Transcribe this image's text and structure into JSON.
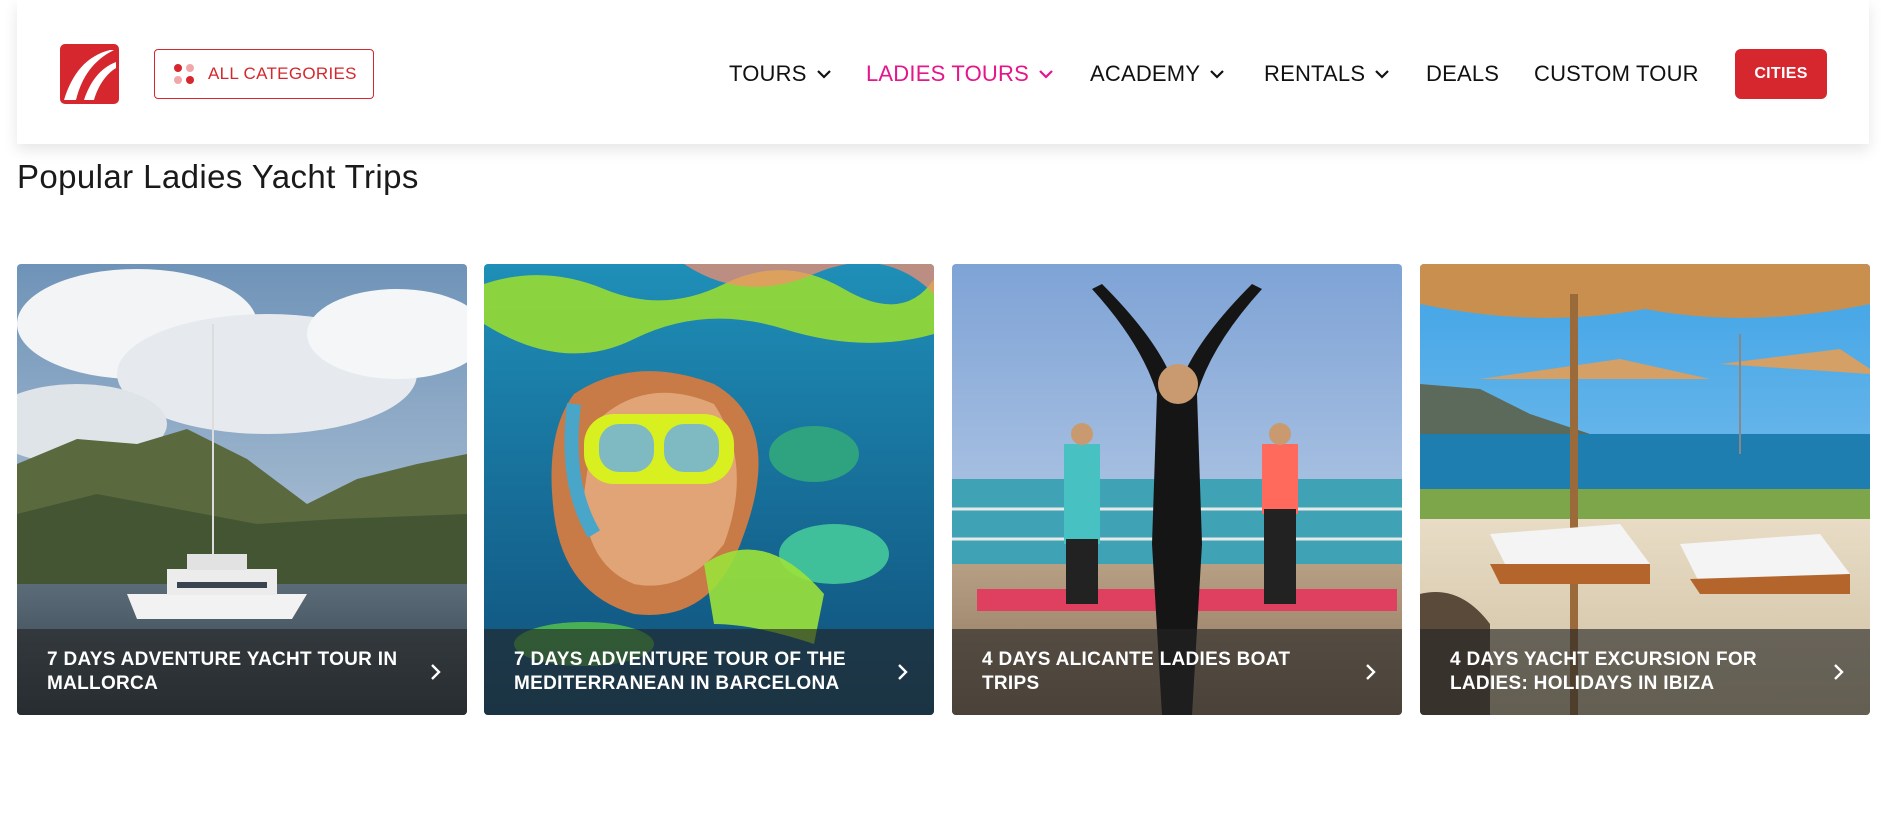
{
  "header": {
    "all_categories_label": "ALL CATEGORIES",
    "nav": [
      {
        "label": "TOURS",
        "has_dropdown": true,
        "active": false
      },
      {
        "label": "LADIES TOURS",
        "has_dropdown": true,
        "active": true
      },
      {
        "label": "ACADEMY",
        "has_dropdown": true,
        "active": false
      },
      {
        "label": "RENTALS",
        "has_dropdown": true,
        "active": false
      },
      {
        "label": "DEALS",
        "has_dropdown": false,
        "active": false
      },
      {
        "label": "CUSTOM TOUR",
        "has_dropdown": false,
        "active": false
      }
    ],
    "cities_label": "CITIES"
  },
  "section": {
    "title": "Popular Ladies Yacht Trips"
  },
  "cards": [
    {
      "title": "7 DAYS ADVENTURE YACHT TOUR IN MALLORCA"
    },
    {
      "title": "7 DAYS ADVENTURE TOUR OF THE MEDITERRANEAN IN BARCELONA"
    },
    {
      "title": "4 DAYS ALICANTE LADIES BOAT TRIPS"
    },
    {
      "title": "4 DAYS YACHT EXCURSION FOR LADIES: HOLIDAYS IN IBIZA"
    }
  ],
  "colors": {
    "brand_red": "#d6262e",
    "active_pink": "#e5158a"
  }
}
